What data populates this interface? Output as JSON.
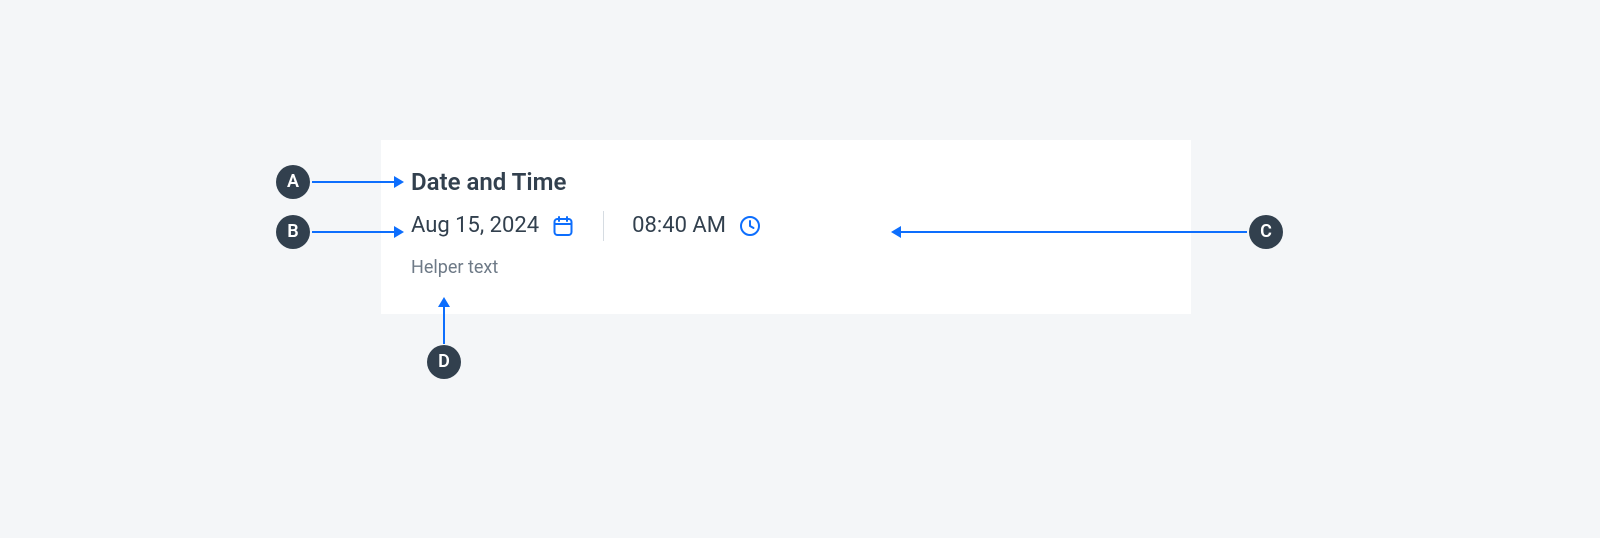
{
  "annotations": {
    "a": "A",
    "b": "B",
    "c": "C",
    "d": "D"
  },
  "component": {
    "title": "Date and Time",
    "date_value": "Aug 15, 2024",
    "time_value": "08:40 AM",
    "helper_text": "Helper text"
  },
  "colors": {
    "accent": "#0d6efd",
    "text_primary": "#32404e",
    "text_secondary": "#6e7a87",
    "marker_bg": "#32404e",
    "card_bg": "#ffffff",
    "page_bg": "#f4f6f8"
  },
  "icons": {
    "calendar": "calendar-icon",
    "clock": "clock-icon"
  }
}
